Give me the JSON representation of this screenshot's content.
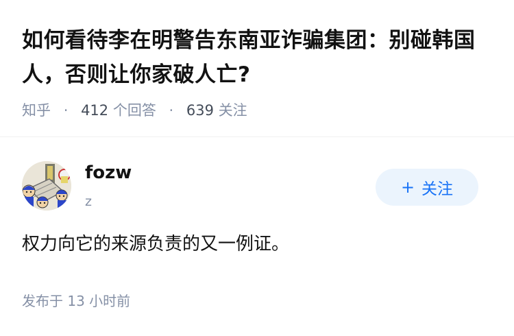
{
  "question": {
    "title": "如何看待李在明警告东南亚诈骗集团：别碰韩国人，否则让你家破人亡?",
    "source": "知乎",
    "answers_count": "412",
    "answers_label": "个回答",
    "followers_count": "639",
    "followers_label": "关注",
    "separator": "·"
  },
  "author": {
    "name": "fozw",
    "bio": "z",
    "avatar_icon": "cartoon-avatar-icon",
    "follow_plus": "+",
    "follow_label": "关注"
  },
  "answer": {
    "content": "权力向它的来源负责的又一例证。",
    "time_prefix": "发布于",
    "time_value": "13",
    "time_unit": "小时前"
  },
  "colors": {
    "muted": "#8590a6",
    "accent": "#1772f6",
    "follow_bg": "#ebf4fd"
  }
}
